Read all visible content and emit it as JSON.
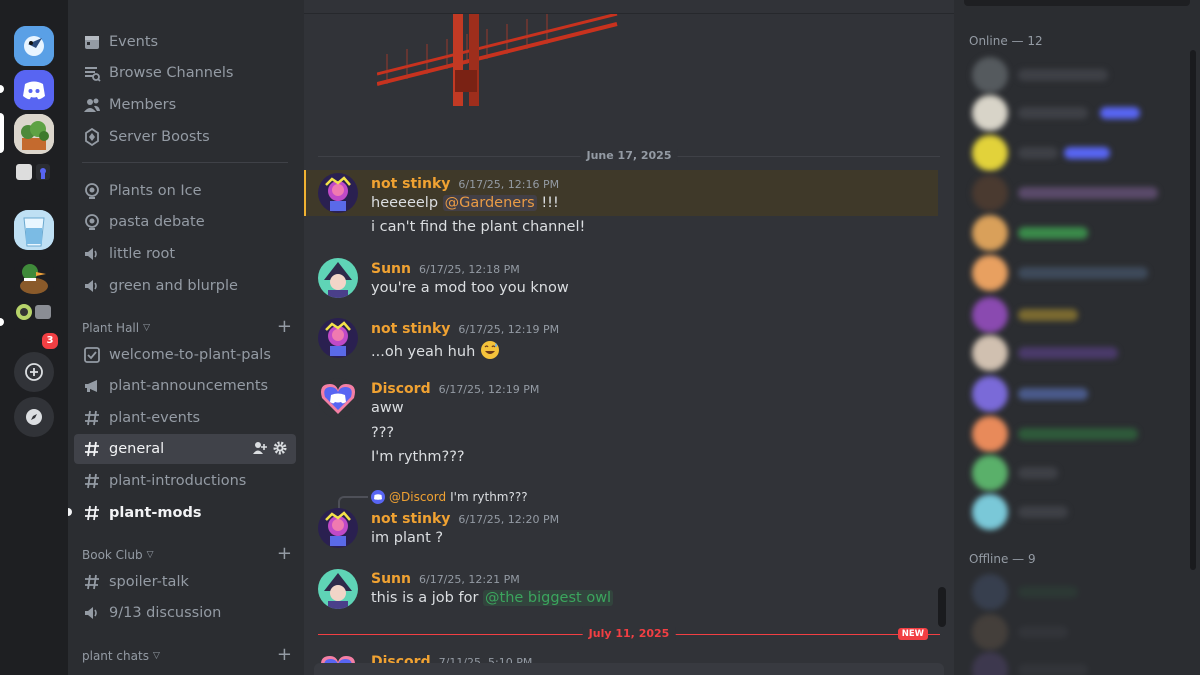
{
  "servers": {
    "notification_count": "3"
  },
  "sidebar": {
    "top_items": [
      {
        "label": "Events",
        "icon": "calendar-icon"
      },
      {
        "label": "Browse Channels",
        "icon": "browse-channels-icon"
      },
      {
        "label": "Members",
        "icon": "members-icon"
      },
      {
        "label": "Server Boosts",
        "icon": "boost-icon"
      }
    ],
    "voice_items": [
      {
        "label": "Plants on Ice",
        "icon": "stage-icon"
      },
      {
        "label": "pasta debate",
        "icon": "stage-icon"
      },
      {
        "label": "little root",
        "icon": "speaker-icon"
      },
      {
        "label": "green and blurple",
        "icon": "speaker-icon"
      }
    ],
    "categories": [
      {
        "name": "Plant Hall",
        "channels": [
          {
            "label": "welcome-to-plant-pals",
            "icon": "rules-icon"
          },
          {
            "label": "plant-announcements",
            "icon": "megaphone-icon"
          },
          {
            "label": "plant-events",
            "icon": "hash-icon"
          },
          {
            "label": "general",
            "icon": "hash-icon",
            "active": true
          },
          {
            "label": "plant-introductions",
            "icon": "hash-icon"
          },
          {
            "label": "plant-mods",
            "icon": "hash-icon",
            "unread": true
          }
        ]
      },
      {
        "name": "Book Club",
        "channels": [
          {
            "label": "spoiler-talk",
            "icon": "hash-icon"
          },
          {
            "label": "9/13 discussion",
            "icon": "speaker-icon"
          }
        ]
      },
      {
        "name": "plant chats",
        "channels": []
      }
    ]
  },
  "chat": {
    "dates": [
      "June 17, 2025",
      "July 11, 2025"
    ],
    "new_label": "NEW",
    "messages": [
      {
        "author": "not stinky",
        "time": "6/17/25, 12:16 PM",
        "lines_pre": "heeeeelp ",
        "mention": "@Gardeners",
        "lines_post": " !!!",
        "line2": "i can't find the plant channel!"
      },
      {
        "author": "Sunn",
        "time": "6/17/25, 12:18 PM",
        "line1": "you're a mod too you know"
      },
      {
        "author": "not stinky",
        "time": "6/17/25, 12:19 PM",
        "line1": "...oh yeah huh"
      },
      {
        "author": "Discord",
        "time": "6/17/25, 12:19 PM",
        "line1": "aww",
        "line2": "???",
        "line3": "I'm rythm???"
      },
      {
        "author": "not stinky",
        "time": "6/17/25, 12:20 PM",
        "line1": "im plant ?",
        "reply_author": "@Discord",
        "reply_text": "I'm rythm???"
      },
      {
        "author": "Sunn",
        "time": "6/17/25, 12:21 PM",
        "lines_pre": "this is a job for ",
        "mention": "@the biggest owl"
      },
      {
        "author": "Discord",
        "time": "7/11/25, 5:10 PM"
      }
    ]
  },
  "members": {
    "online_header": "Online — 12",
    "offline_header": "Offline — 9"
  },
  "colors": {
    "accent": "#5865f2",
    "username_orange": "#f0a232",
    "mention_green": "#3ba55d",
    "new_red": "#f23f43"
  }
}
